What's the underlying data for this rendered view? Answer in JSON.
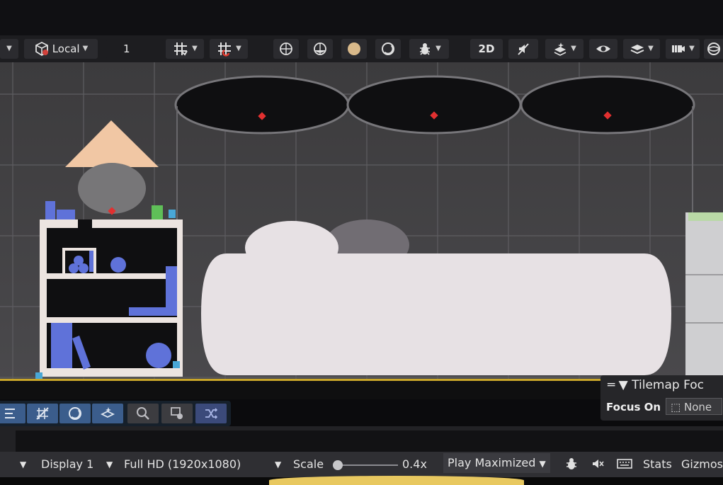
{
  "toolbar": {
    "pivot_rotation": "Local",
    "increment_value": "1",
    "view_2d_label": "2D",
    "icons": [
      "local-cube-icon",
      "grid-snap-icon",
      "grid-visibility-icon",
      "wireframe-shading-icon",
      "shaded-wireframe-icon",
      "shaded-icon",
      "lighting-icon",
      "debug-bug-icon",
      "2d-toggle",
      "audio-mute-icon",
      "effects-icon",
      "visibility-eye-icon",
      "layers-icon",
      "scene-camera-icon",
      "gizmo-sphere-icon"
    ]
  },
  "tilemap_panel": {
    "title": "Tilemap Foc",
    "focus_label": "Focus On",
    "focus_value": "None"
  },
  "tile_palette": {
    "tools": [
      "select-tool",
      "erase-tool",
      "paint-tool",
      "fill-tool",
      "picker-tool",
      "box-tool",
      "shuffle-tool"
    ]
  },
  "game_bar": {
    "display": "Display 1",
    "resolution": "Full HD (1920x1080)",
    "scale_label": "Scale",
    "scale_value": "0.4x",
    "scale_fraction": 0.0,
    "play_mode": "Play Maximized",
    "stats": "Stats",
    "gizmos": "Gizmos"
  },
  "colors": {
    "scene_bg": "#48484b",
    "sofa": "#e7e1e4",
    "bookshelf": "#ece4e0",
    "blue_objects": "#5f72d9",
    "lamp_shade": "#f1c7a4",
    "accent_selected": "#3b5d8c",
    "marker_red": "#e23030"
  }
}
